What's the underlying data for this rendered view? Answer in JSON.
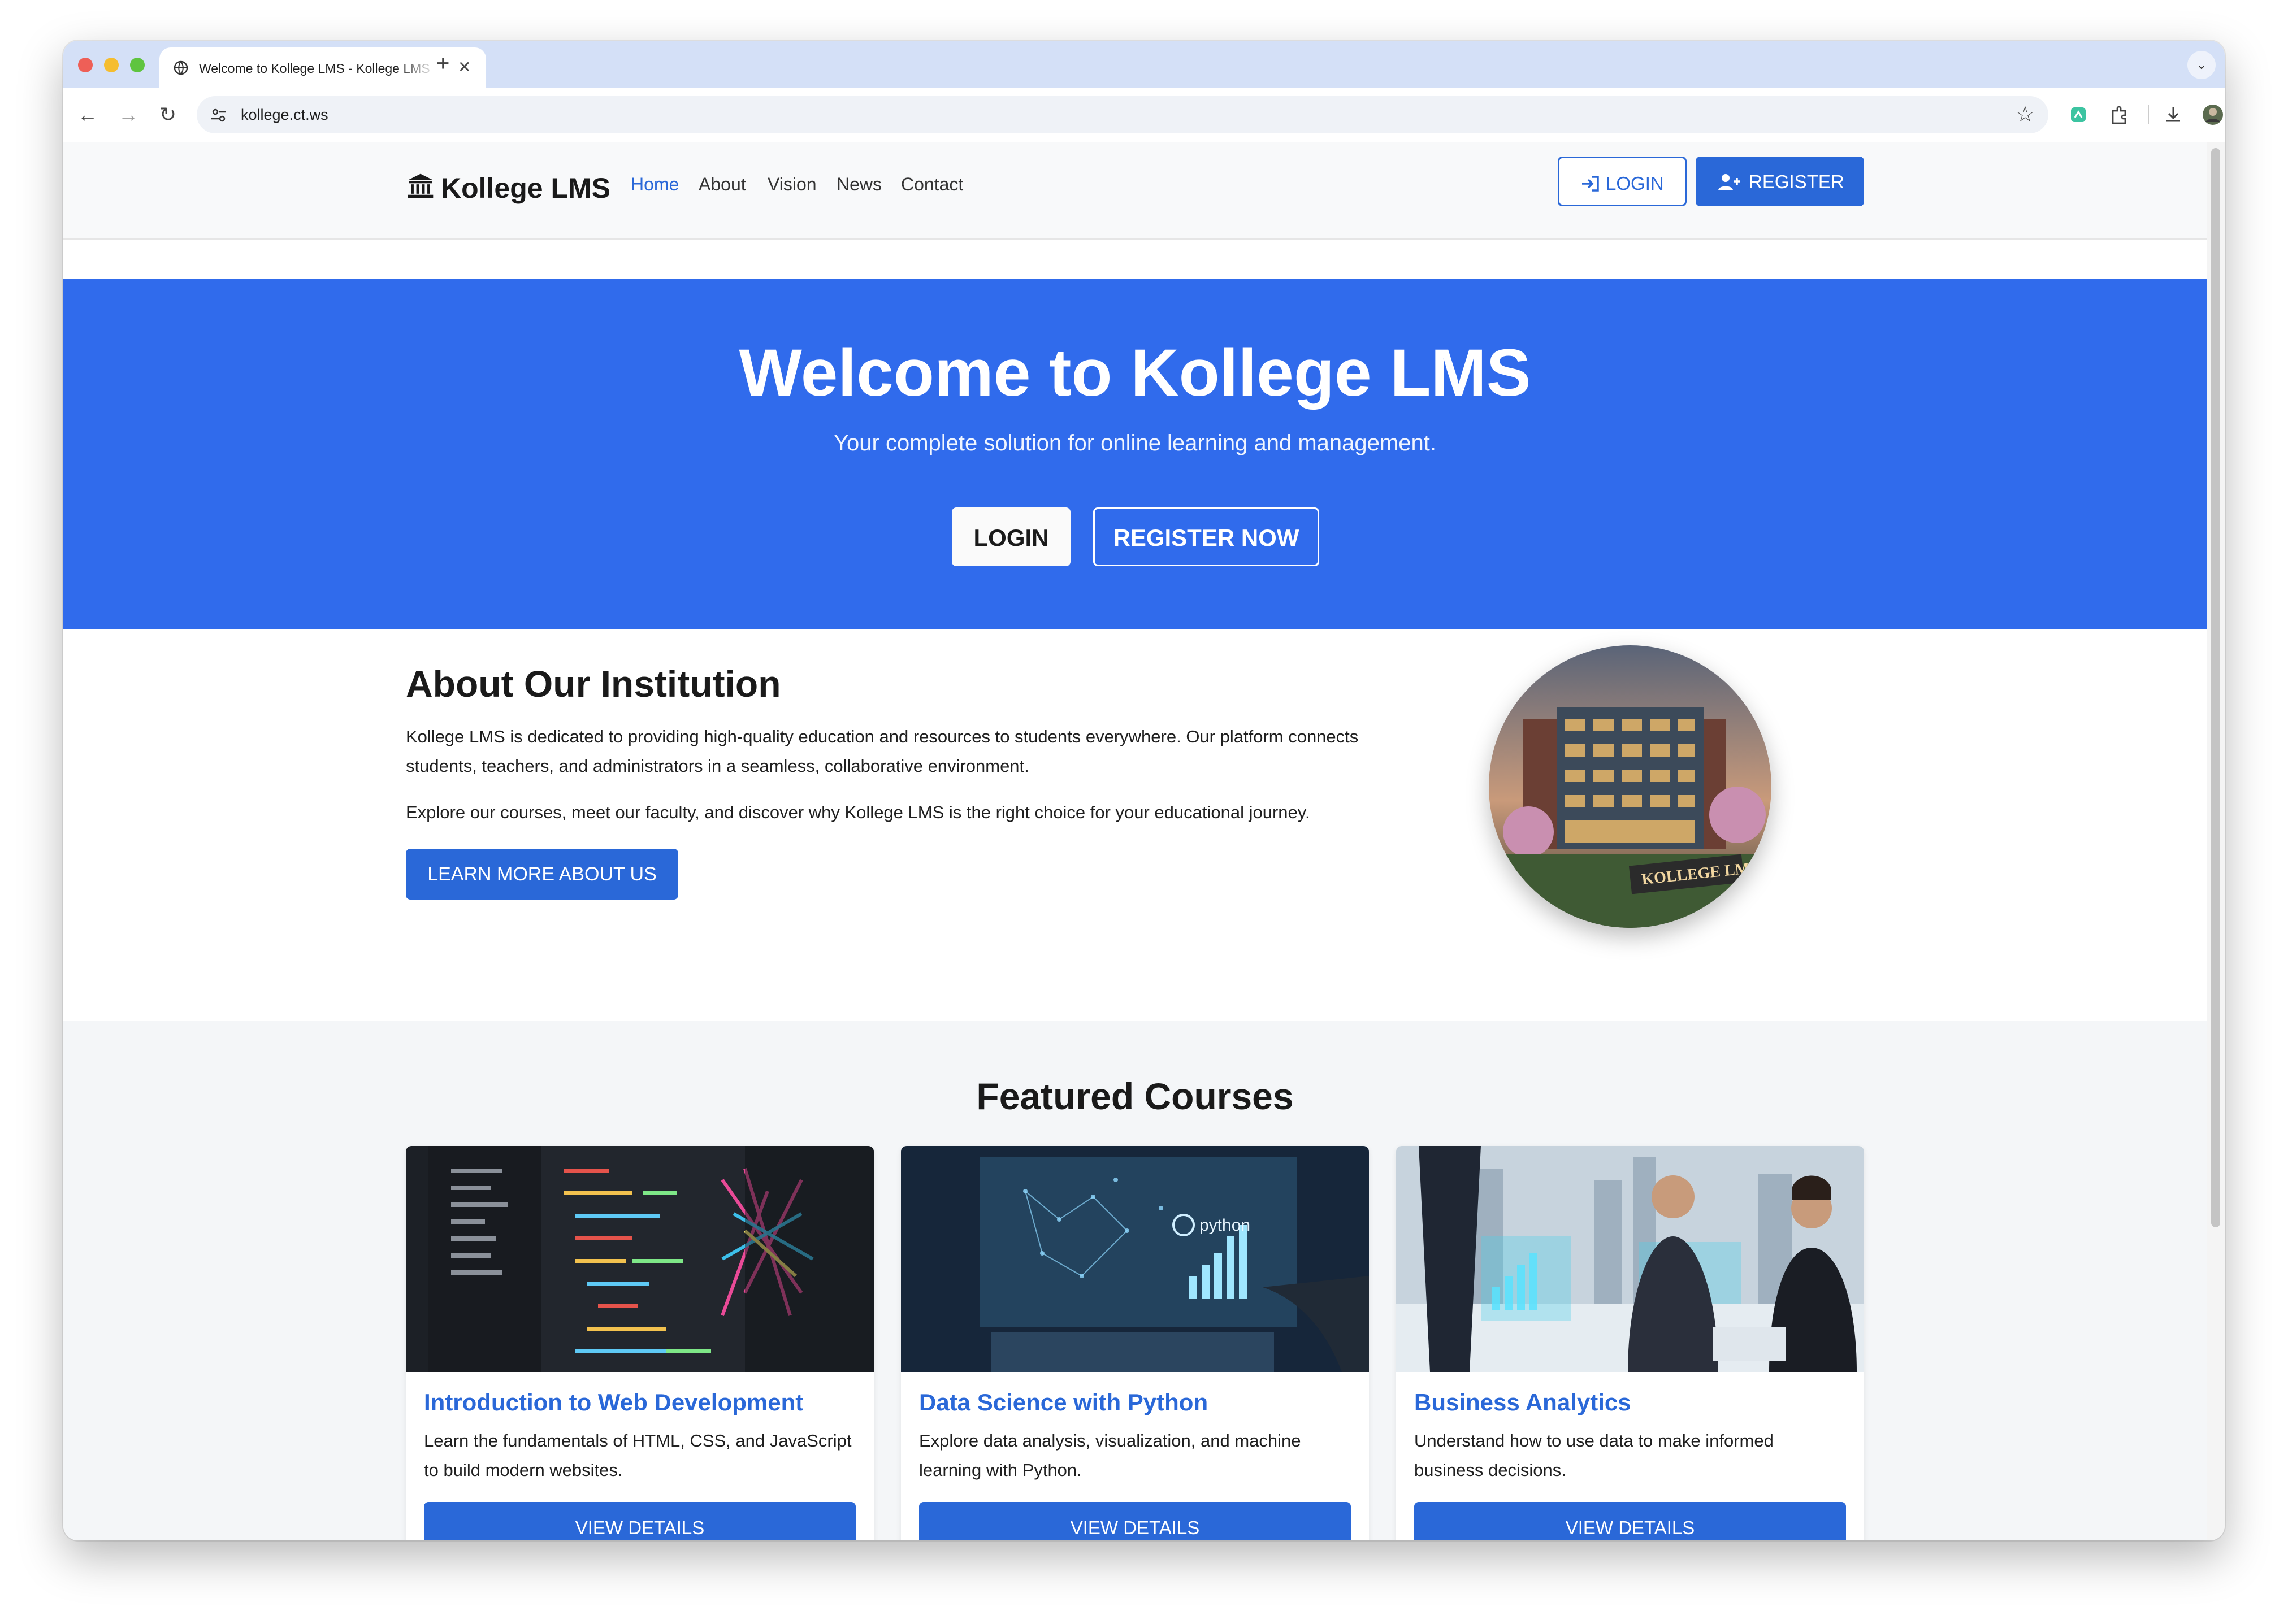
{
  "browser": {
    "tab_title": "Welcome to Kollege LMS - Kollege LMS",
    "url": "kollege.ct.ws"
  },
  "site": {
    "brand": "Kollege LMS",
    "nav": [
      {
        "label": "Home",
        "active": true
      },
      {
        "label": "About",
        "active": false
      },
      {
        "label": "Vision",
        "active": false
      },
      {
        "label": "News",
        "active": false
      },
      {
        "label": "Contact",
        "active": false
      }
    ],
    "login_label": "LOGIN",
    "register_label": "REGISTER"
  },
  "hero": {
    "title": "Welcome to Kollege LMS",
    "subtitle": "Your complete solution for online learning and management.",
    "login_label": "LOGIN",
    "register_label": "REGISTER NOW"
  },
  "about": {
    "title": "About Our Institution",
    "p1": "Kollege LMS is dedicated to providing high-quality education and resources to students everywhere. Our platform connects students, teachers, and administrators in a seamless, collaborative environment.",
    "p2": "Explore our courses, meet our faculty, and discover why Kollege LMS is the right choice for your educational journey.",
    "button": "LEARN MORE ABOUT US",
    "image_sign": "KOLLEGE LMS"
  },
  "courses": {
    "title": "Featured Courses",
    "items": [
      {
        "title": "Introduction to Web Development",
        "desc": "Learn the fundamentals of HTML, CSS, and JavaScript to build modern websites.",
        "button": "VIEW DETAILS"
      },
      {
        "title": "Data Science with Python",
        "desc": "Explore data analysis, visualization, and machine learning with Python.",
        "button": "VIEW DETAILS",
        "image_label": "python"
      },
      {
        "title": "Business Analytics",
        "desc": "Understand how to use data to make informed business decisions.",
        "button": "VIEW DETAILS"
      }
    ]
  },
  "colors": {
    "primary": "#2a68d8",
    "hero_bg": "#306bec",
    "tabstrip": "#d4e0f7"
  }
}
